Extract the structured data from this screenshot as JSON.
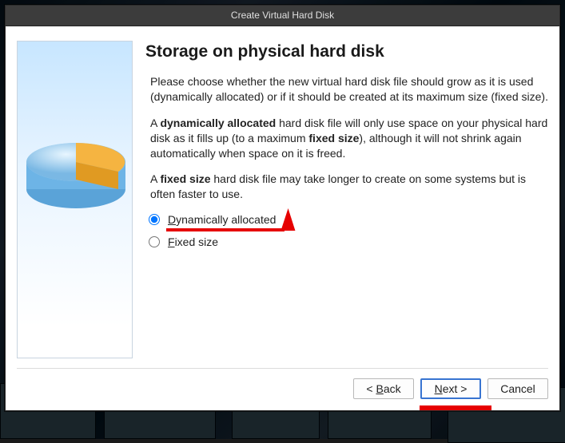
{
  "window": {
    "title": "Create Virtual Hard Disk"
  },
  "heading": "Storage on physical hard disk",
  "paragraphs": {
    "intro": "Please choose whether the new virtual hard disk file should grow as it is used (dynamically allocated) or if it should be created at its maximum size (fixed size).",
    "dyn_pre": "A ",
    "dyn_bold": "dynamically allocated",
    "dyn_mid": " hard disk file will only use space on your physical hard disk as it fills up (to a maximum ",
    "dyn_bold2": "fixed size",
    "dyn_post": "), although it will not shrink again automatically when space on it is freed.",
    "fixed_pre": "A ",
    "fixed_bold": "fixed size",
    "fixed_post": " hard disk file may take longer to create on some systems but is often faster to use."
  },
  "options": {
    "dynamic": {
      "mn": "D",
      "rest": "ynamically allocated",
      "selected": true
    },
    "fixed": {
      "mn": "F",
      "rest": "ixed size",
      "selected": false
    }
  },
  "buttons": {
    "back": {
      "pre": "< ",
      "mn": "B",
      "rest": "ack"
    },
    "next": {
      "mn": "N",
      "rest": "ext >"
    },
    "cancel": {
      "label": "Cancel"
    }
  },
  "annotation": {
    "color": "#e60000"
  }
}
